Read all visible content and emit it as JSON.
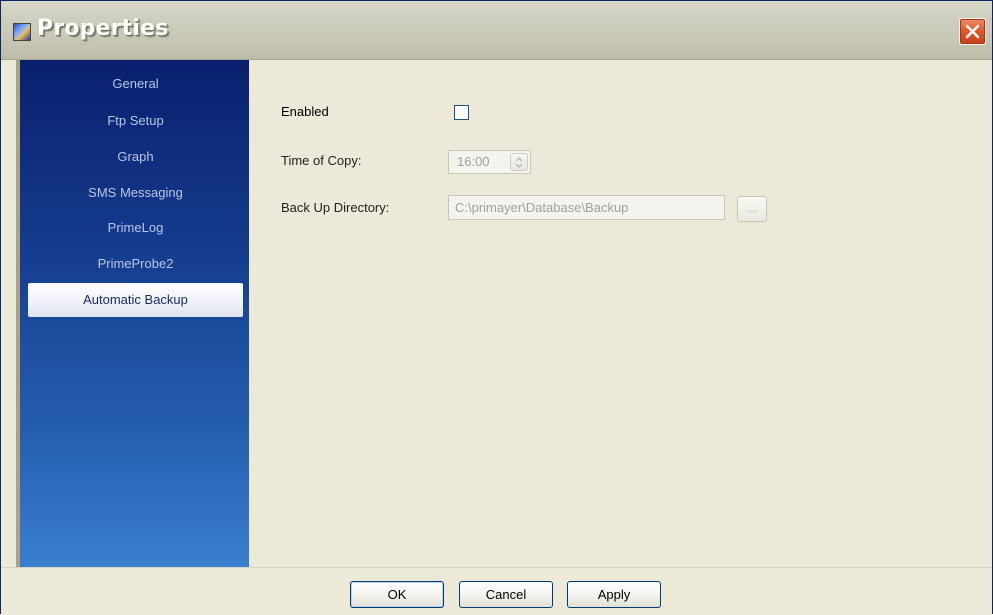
{
  "window": {
    "title": "Properties"
  },
  "sidebar": {
    "items": [
      {
        "label": "General",
        "active": false
      },
      {
        "label": "Ftp Setup",
        "active": false
      },
      {
        "label": "Graph",
        "active": false
      },
      {
        "label": "SMS Messaging",
        "active": false
      },
      {
        "label": "PrimeLog",
        "active": false
      },
      {
        "label": "PrimeProbe2",
        "active": false
      },
      {
        "label": "Automatic Backup",
        "active": true
      }
    ]
  },
  "form": {
    "enabled_label": "Enabled",
    "enabled_checked": false,
    "time_label": "Time of Copy:",
    "time_value": "16:00",
    "dir_label": "Back Up Directory:",
    "dir_value": "C:\\primayer\\Database\\Backup",
    "browse_label": "..."
  },
  "buttons": {
    "ok": "OK",
    "cancel": "Cancel",
    "apply": "Apply"
  },
  "colors": {
    "sidebar_top": "#0a1f6e",
    "sidebar_bottom": "#3a7fd0",
    "close_button": "#e05a2c",
    "background": "#ece9d8"
  }
}
